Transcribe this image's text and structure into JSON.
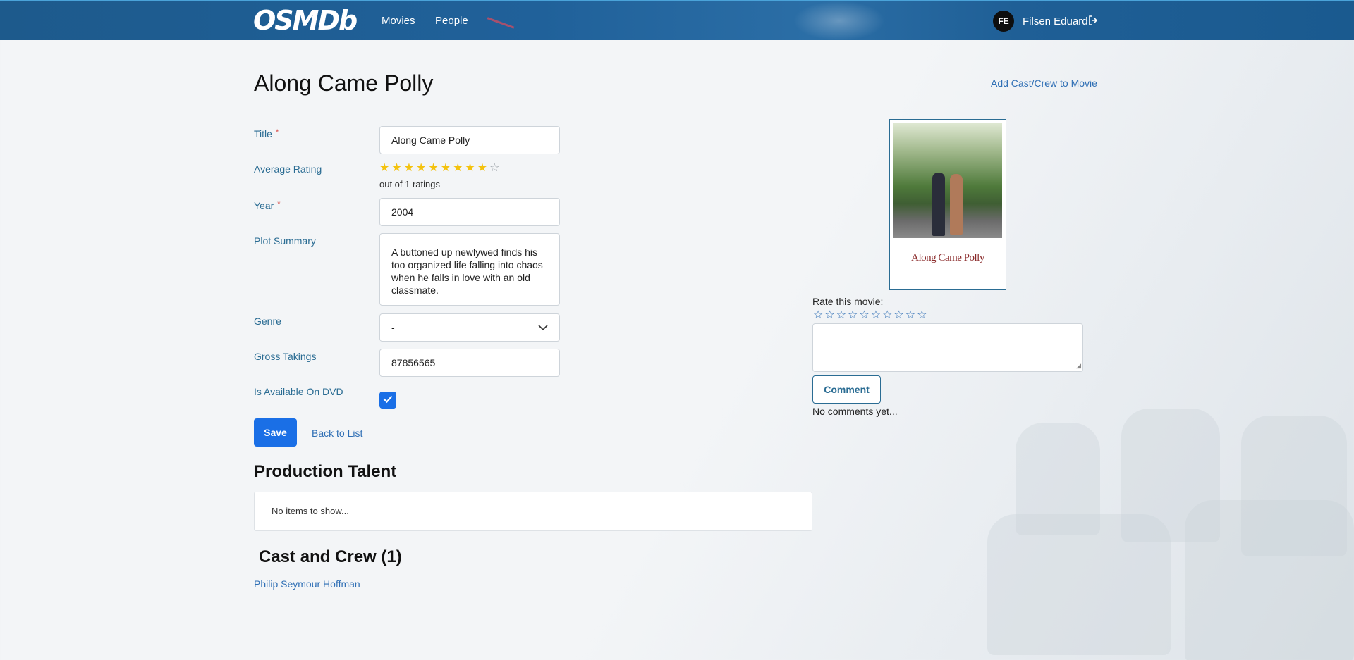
{
  "nav": {
    "logo": "OSMDb",
    "links": [
      "Movies",
      "People"
    ],
    "user_initials": "FE",
    "user_name": "Filsen Eduard"
  },
  "page": {
    "title": "Along Came Polly",
    "add_cast_link": "Add Cast/Crew to Movie"
  },
  "form": {
    "title_label": "Title",
    "title_value": "Along Came Polly",
    "rating_label": "Average Rating",
    "rating_value": 9,
    "rating_max": 10,
    "ratings_count_text": "out of 1 ratings",
    "year_label": "Year",
    "year_value": "2004",
    "plot_label": "Plot Summary",
    "plot_value": "A buttoned up newlywed finds his too organized life falling into chaos when he falls in love with an old classmate.",
    "genre_label": "Genre",
    "genre_value": "-",
    "gross_label": "Gross Takings",
    "gross_value": "87856565",
    "dvd_label": "Is Available On DVD",
    "dvd_checked": true,
    "required_mark": "*",
    "save_label": "Save",
    "back_label": "Back to List"
  },
  "production": {
    "title": "Production Talent",
    "empty_text": "No items to show..."
  },
  "cast": {
    "title": "Cast and Crew (1)",
    "members": [
      "Philip Seymour Hoffman"
    ]
  },
  "sidebar": {
    "poster_title": "Along Came Polly",
    "rate_label": "Rate this movie:",
    "rate_max": 10,
    "comment_button": "Comment",
    "no_comments": "No comments yet..."
  }
}
